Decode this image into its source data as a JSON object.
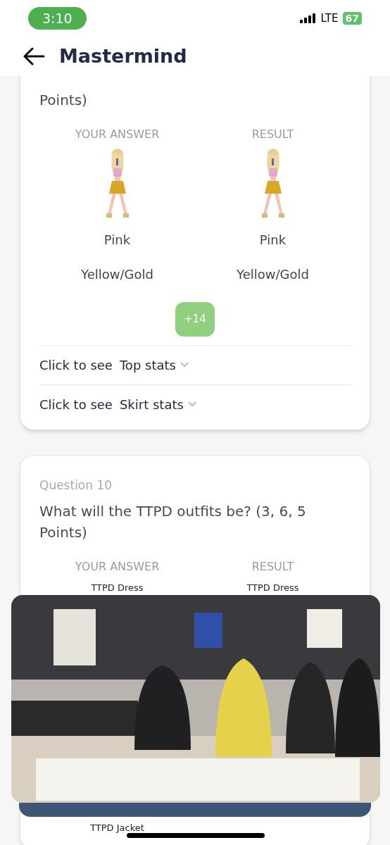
{
  "status_bar": {
    "time": "3:10",
    "network": "LTE",
    "battery": "67"
  },
  "header": {
    "title": "Mastermind"
  },
  "cards": [
    {
      "question": "Points)",
      "answer_heading": "YOUR ANSWER",
      "result_heading": "RESULT",
      "kind": "colors",
      "answers": [
        "Pink",
        "Yellow/Gold"
      ],
      "results": [
        "Pink",
        "Yellow/Gold"
      ],
      "score": "+14",
      "stats": [
        {
          "prefix": "Click to see",
          "name": "Top stats",
          "expanded": false
        },
        {
          "prefix": "Click to see",
          "name": "Skirt stats",
          "expanded": false
        }
      ]
    },
    {
      "label": "Question 10",
      "question": "What will the TTPD outfits be? (3, 6, 5 Points)",
      "answer_heading": "YOUR ANSWER",
      "result_heading": "RESULT",
      "kind": "outfits",
      "answers": [
        "TTPD Dress",
        "TTPD Jacket"
      ],
      "results": [
        "TTPD Dress"
      ]
    }
  ]
}
